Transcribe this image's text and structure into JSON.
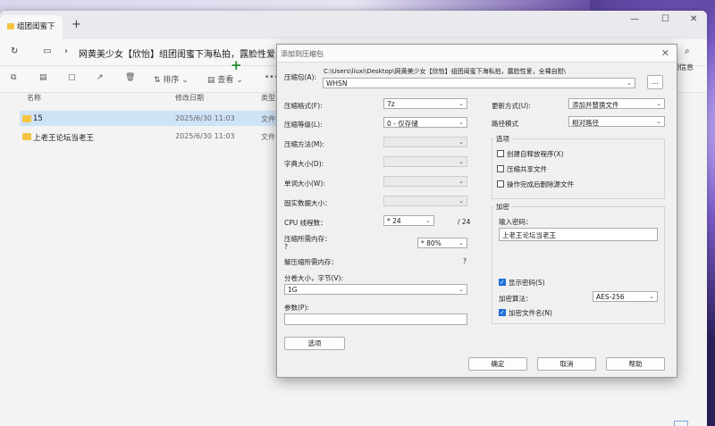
{
  "tab": {
    "title": "组团闺蜜下"
  },
  "address": {
    "path": "网黄美少女【欣怡】组团闺蜜下海私拍，露脸性爱，全"
  },
  "toolbar": {
    "sort_label": "排序",
    "view_label": "查看",
    "more_label": "•••",
    "details_label": "细信息"
  },
  "columns": {
    "name": "名称",
    "date": "修改日期",
    "type": "类型"
  },
  "files": [
    {
      "name": "15",
      "date": "2025/6/30 11:03",
      "type": "文件"
    },
    {
      "name": "上老王论坛当老王",
      "date": "2025/6/30 11:03",
      "type": "文件"
    }
  ],
  "dialog": {
    "title": "添加到压缩包",
    "archive_label": "压缩包(A):",
    "archive_path": "C:\\Users\\liuxi\\Desktop\\网黄美少女【欣怡】组团闺蜜下海私拍，露脸性爱，全裸自慰\\",
    "archive_name": "WHSN",
    "browse": "...",
    "format_label": "压缩格式(F):",
    "format_value": "7z",
    "level_label": "压缩等级(L):",
    "level_value": "0 - 仅存储",
    "method_label": "压缩方法(M):",
    "dict_label": "字典大小(D):",
    "word_label": "单词大小(W):",
    "solid_label": "固实数据大小：",
    "cpu_label": "CPU 线程数：",
    "cpu_value": "* 24",
    "cpu_max": "/ 24",
    "mem_label": "压缩所需内存：",
    "mem_q": "?",
    "mem_value": "* 80%",
    "decomp_label": "解压缩所需内存：",
    "decomp_value": "?",
    "split_label": "分卷大小，字节(V):",
    "split_value": "1G",
    "params_label": "参数(P):",
    "options_btn": "选项",
    "update_label": "更新方式(U):",
    "update_value": "添加并替换文件",
    "path_label": "路径模式",
    "path_value": "相对路径",
    "options_group": "选项",
    "opt_sfx": "创建自释放程序(X)",
    "opt_shared": "压缩共享文件",
    "opt_delete": "操作完成后删除源文件",
    "encrypt_group": "加密",
    "password_label": "输入密码：",
    "password_value": "上老王论坛当老王",
    "show_password": "显示密码(S)",
    "enc_method_label": "加密算法：",
    "enc_method_value": "AES-256",
    "enc_names": "加密文件名(N)",
    "ok": "确定",
    "cancel": "取消",
    "help": "帮助"
  }
}
